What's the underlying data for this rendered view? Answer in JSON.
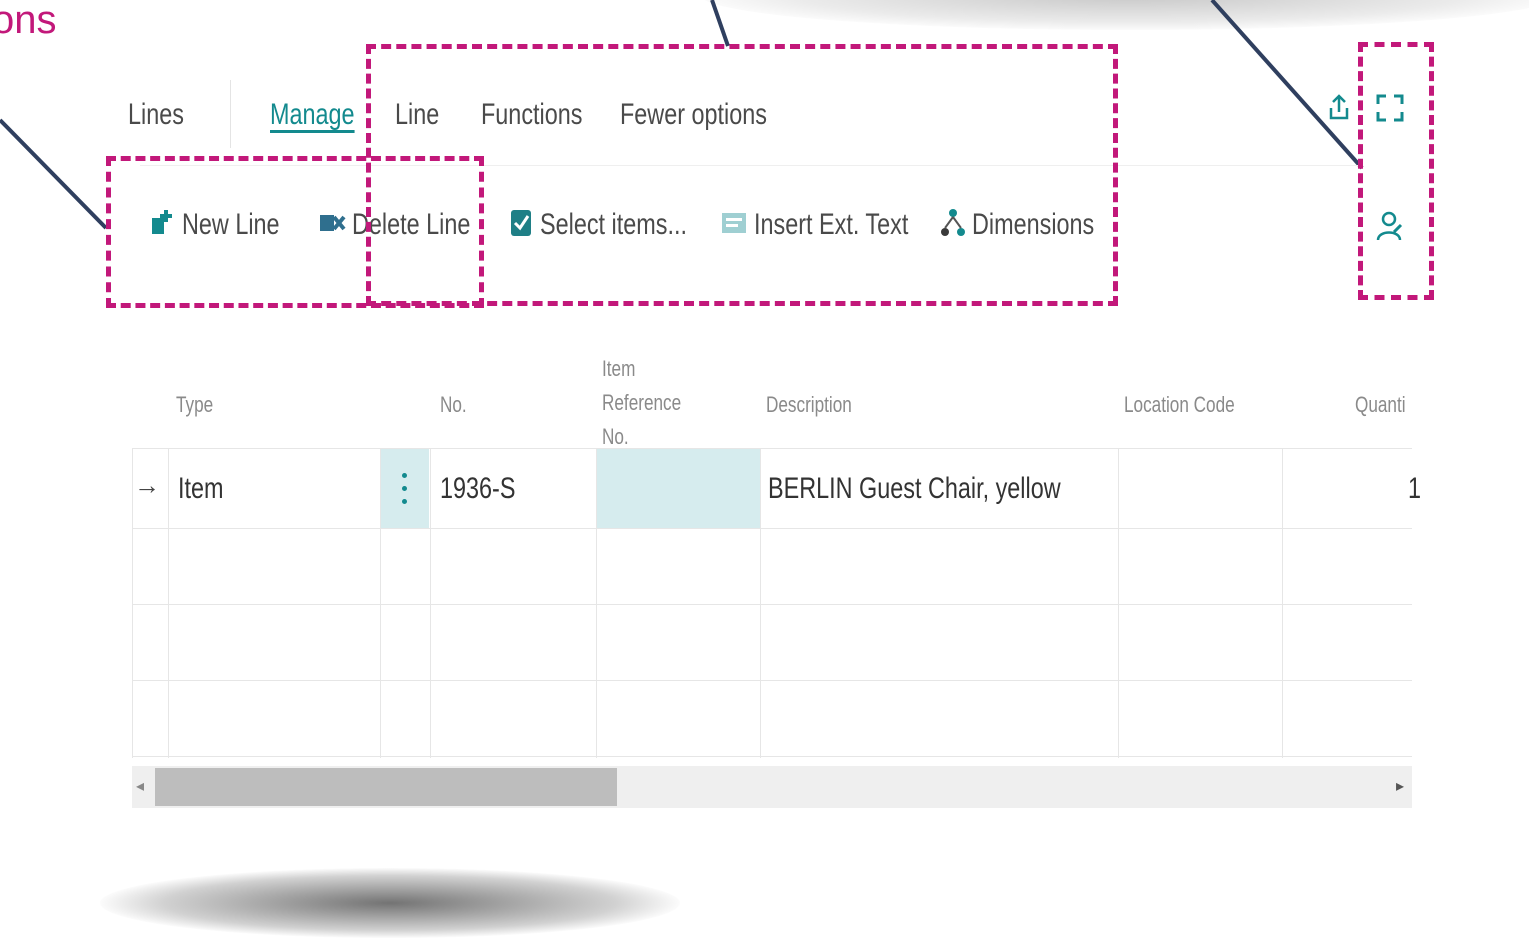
{
  "callout_text": "ons",
  "tabs": [
    {
      "label": "Lines",
      "active": false
    },
    {
      "label": "Manage",
      "active": true
    },
    {
      "label": "Line",
      "active": false
    },
    {
      "label": "Functions",
      "active": false
    },
    {
      "label": "Fewer options",
      "active": false
    }
  ],
  "actions": [
    {
      "label": "New Line",
      "icon": "new-line-icon"
    },
    {
      "label": "Delete Line",
      "icon": "delete-line-icon"
    },
    {
      "label": "Select items...",
      "icon": "select-items-icon"
    },
    {
      "label": "Insert Ext. Text",
      "icon": "insert-ext-text-icon"
    },
    {
      "label": "Dimensions",
      "icon": "dimensions-icon"
    }
  ],
  "toolbar_icons": [
    "share-icon",
    "expand-icon",
    "personalize-icon"
  ],
  "columns": [
    "Type",
    "No.",
    "Item Reference No.",
    "Description",
    "Location Code",
    "Quanti"
  ],
  "rows": [
    {
      "type": "Item",
      "no": "1936-S",
      "item_reference_no": "",
      "description": "BERLIN Guest Chair, yellow",
      "location_code": "",
      "quantity": "1"
    },
    {
      "type": "",
      "no": "",
      "item_reference_no": "",
      "description": "",
      "location_code": "",
      "quantity": ""
    },
    {
      "type": "",
      "no": "",
      "item_reference_no": "",
      "description": "",
      "location_code": "",
      "quantity": ""
    },
    {
      "type": "",
      "no": "",
      "item_reference_no": "",
      "description": "",
      "location_code": "",
      "quantity": ""
    }
  ],
  "colors": {
    "accent": "#138a8e",
    "callout": "#c2187a",
    "selected_cell": "#d6ecee",
    "row_border": "#e6e6e6"
  }
}
